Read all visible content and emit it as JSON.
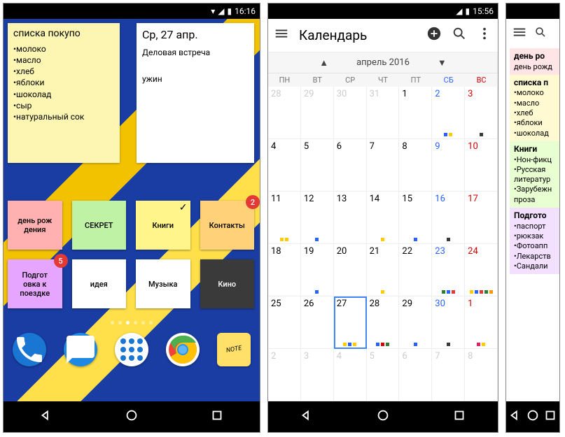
{
  "phone1": {
    "time": "16:16",
    "shopping": {
      "title": "списка покупо",
      "items": [
        "молоко",
        "масло",
        "хлеб",
        "яблоки",
        "шоколад",
        "сыр",
        "натуральный сок"
      ]
    },
    "today": {
      "date": "Ср, 27 апр.",
      "meeting": "Деловая встреча",
      "dinner": "ужин"
    },
    "tiles": [
      {
        "label": "день рож\nдения",
        "bg": "#ffb0b0",
        "badge": null,
        "check": false
      },
      {
        "label": "СЕКРЕТ",
        "bg": "#bff2a5",
        "badge": null,
        "check": false
      },
      {
        "label": "Книги",
        "bg": "#fff58a",
        "badge": null,
        "check": true
      },
      {
        "label": "Контакты",
        "bg": "#ffd27a",
        "badge": "2",
        "check": false
      },
      {
        "label": "Подгот\nовка к\nпоездке",
        "bg": "#e6a6ff",
        "badge": "5",
        "check": false
      },
      {
        "label": "идея",
        "bg": "#ffffff",
        "badge": null,
        "check": false
      },
      {
        "label": "Музыка",
        "bg": "#ffffff",
        "badge": null,
        "check": false
      },
      {
        "label": "Кино",
        "bg": "#3a3a3a",
        "fg": "#fff",
        "badge": null,
        "check": false
      }
    ]
  },
  "phone2": {
    "time": "15:56",
    "title": "Календарь",
    "month": "апрель 2016",
    "dow": [
      "ПН",
      "ВТ",
      "СР",
      "ЧТ",
      "ПТ",
      "СБ",
      "ВС"
    ],
    "weeks": [
      [
        {
          "n": 28,
          "o": true,
          "d": []
        },
        {
          "n": 29,
          "o": true,
          "d": []
        },
        {
          "n": 30,
          "o": true,
          "d": []
        },
        {
          "n": 31,
          "o": true,
          "d": []
        },
        {
          "n": 1,
          "d": []
        },
        {
          "n": 2,
          "sat": true,
          "d": [
            "#2962ff",
            "#ffcc00"
          ]
        },
        {
          "n": 3,
          "sun": true,
          "d": [
            "#3a3a3a"
          ]
        }
      ],
      [
        {
          "n": 4,
          "d": []
        },
        {
          "n": 5,
          "d": []
        },
        {
          "n": 6,
          "d": []
        },
        {
          "n": 7,
          "d": []
        },
        {
          "n": 8,
          "d": []
        },
        {
          "n": 9,
          "sat": true,
          "d": []
        },
        {
          "n": 10,
          "sun": true,
          "d": []
        }
      ],
      [
        {
          "n": 11,
          "d": [
            "#ffcc00",
            "#ffcc00"
          ]
        },
        {
          "n": 12,
          "d": [
            "#2962ff"
          ]
        },
        {
          "n": 13,
          "d": []
        },
        {
          "n": 14,
          "d": [
            "#ffcc00"
          ]
        },
        {
          "n": 15,
          "d": [
            "#2962ff"
          ]
        },
        {
          "n": 16,
          "sat": true,
          "d": [
            "#3a3a3a"
          ]
        },
        {
          "n": 17,
          "sun": true,
          "d": []
        }
      ],
      [
        {
          "n": 18,
          "d": []
        },
        {
          "n": 19,
          "d": [
            "#2962ff"
          ]
        },
        {
          "n": 20,
          "d": []
        },
        {
          "n": 21,
          "d": [
            "#ffcc00"
          ]
        },
        {
          "n": 22,
          "d": []
        },
        {
          "n": 23,
          "sat": true,
          "d": [
            "#2e7d32",
            "#2962ff",
            "#e53935"
          ]
        },
        {
          "n": 24,
          "sun": true,
          "d": [
            "#ffcc00",
            "#2962ff",
            "#e53935",
            "#2e7d32",
            "#ff9800"
          ]
        }
      ],
      [
        {
          "n": 25,
          "d": []
        },
        {
          "n": 26,
          "d": []
        },
        {
          "n": 27,
          "today": true,
          "d": [
            "#ffcc00",
            "#2962ff",
            "#ffcc00"
          ]
        },
        {
          "n": 28,
          "d": [
            "#2962ff",
            "#d50000",
            "#2e7d32"
          ]
        },
        {
          "n": 29,
          "d": [
            "#2962ff"
          ]
        },
        {
          "n": 30,
          "sat": true,
          "d": [
            "#3a3a3a"
          ]
        },
        {
          "n": 1,
          "o": true,
          "sun": true,
          "d": [
            "#e91e63",
            "#ffcc00"
          ]
        }
      ],
      [
        {
          "n": 2,
          "o": true,
          "d": []
        },
        {
          "n": 3,
          "o": true,
          "d": []
        },
        {
          "n": 4,
          "o": true,
          "d": []
        },
        {
          "n": 5,
          "o": true,
          "d": []
        },
        {
          "n": 6,
          "o": true,
          "d": []
        },
        {
          "n": 7,
          "o": true,
          "d": []
        },
        {
          "n": 8,
          "o": true,
          "d": []
        }
      ]
    ]
  },
  "phone3": {
    "notes": [
      {
        "accent": "#ffb0b0",
        "bg": "#ffe5e5",
        "title": "день ро",
        "lines": [
          "день рожд"
        ]
      },
      {
        "accent": "#fff17a",
        "bg": "#fffad1",
        "title": "списка п",
        "lines": [
          "•молоко",
          "•масло",
          "•хлеб",
          "•яблоки",
          "•шоколад"
        ]
      },
      {
        "accent": "#b7ff7a",
        "bg": "#e8ffd1",
        "title": "Книги",
        "lines": [
          "•Нон-фикц",
          "•Русская",
          "литератур",
          "•Зарубежн",
          "проза"
        ]
      },
      {
        "accent": "#e0a8ff",
        "bg": "#f3e0ff",
        "title": "Подгото",
        "lines": [
          "•паспорт",
          "•рюкзак",
          "•Фотоапп",
          "•Лекарств",
          "•Сандали"
        ]
      }
    ]
  }
}
